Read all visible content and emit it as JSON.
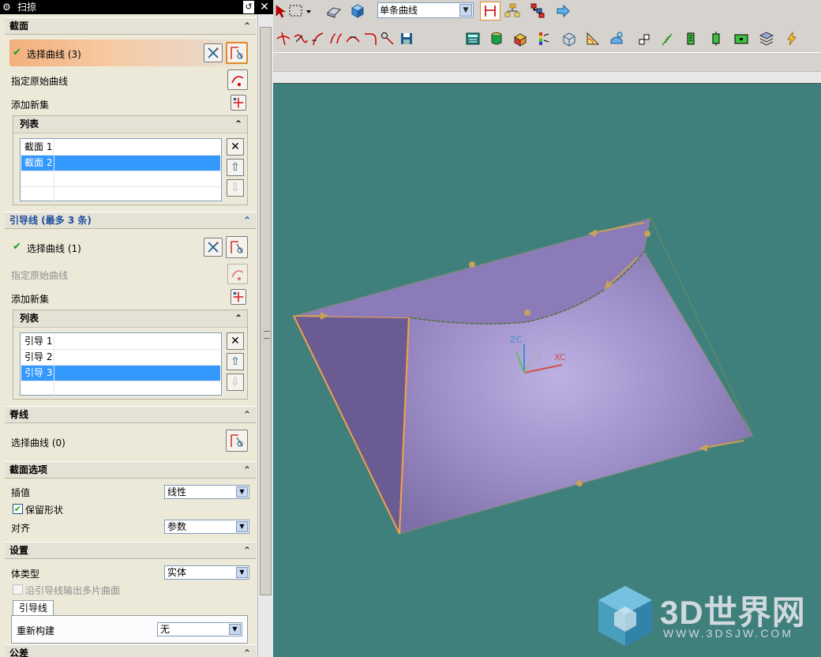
{
  "dialog": {
    "title": "扫掠",
    "section": {
      "label": "截面",
      "select_curve": "选择曲线 (3)",
      "specify_origin": "指定原始曲线",
      "add_set": "添加新集",
      "list": {
        "label": "列表",
        "items": [
          {
            "c1": "截面",
            "c2": "1"
          },
          {
            "c1": "截面",
            "c2": "2"
          }
        ]
      }
    },
    "guides": {
      "label": "引导线 (最多 3 条)",
      "select_curve": "选择曲线 (1)",
      "specify_origin": "指定原始曲线",
      "add_set": "添加新集",
      "list": {
        "label": "列表",
        "items": [
          {
            "c1": "引导",
            "c2": "1"
          },
          {
            "c1": "引导",
            "c2": "2"
          },
          {
            "c1": "引导",
            "c2": "3"
          }
        ]
      }
    },
    "spine": {
      "label": "脊线",
      "select_curve": "选择曲线 (0)"
    },
    "section_options": {
      "label": "截面选项",
      "interpolation_label": "插值",
      "interpolation_value": "线性",
      "preserve_shape": "保留形状",
      "preserve_shape_checked": true,
      "alignment_label": "对齐",
      "alignment_value": "参数"
    },
    "settings": {
      "label": "设置",
      "body_type_label": "体类型",
      "body_type_value": "实体",
      "multi_surface": "沿引导线输出多片曲面",
      "tab_label": "引导线",
      "rebuild_label": "重新构建",
      "rebuild_value": "无"
    },
    "tolerance": {
      "label": "公差"
    }
  },
  "toolbar": {
    "filter_value": "单条曲线"
  },
  "viewport": {
    "axis_zc": "ZC",
    "axis_xc": "XC",
    "background_color": "#3f7f7c",
    "surface_color": "#9a8ac4"
  },
  "watermark": {
    "brand": "3D世界网",
    "url": "WWW.3DSJW.COM"
  }
}
